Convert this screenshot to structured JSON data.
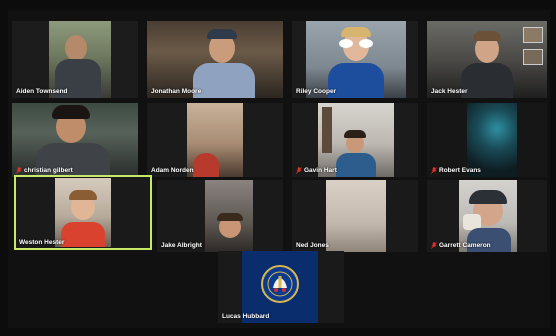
{
  "app": {
    "name": "Zoom gallery view"
  },
  "colors": {
    "active_speaker": "#c9e86a",
    "muted_icon": "#e0312b",
    "background": "#0b0b0b"
  },
  "participants": [
    {
      "name": "Aiden Townsend",
      "muted": false
    },
    {
      "name": "Jonathan Moore",
      "muted": false
    },
    {
      "name": "Riley Cooper",
      "muted": false
    },
    {
      "name": "Jack Hester",
      "muted": false
    },
    {
      "name": "christian gilbert",
      "muted": true
    },
    {
      "name": "Adam Norden",
      "muted": false
    },
    {
      "name": "Gavin Hart",
      "muted": true
    },
    {
      "name": "Robert Evans",
      "muted": true
    },
    {
      "name": "Weston Hester",
      "muted": false,
      "active_speaker": true
    },
    {
      "name": "Jake Albright",
      "muted": false
    },
    {
      "name": "Ned Jones",
      "muted": false
    },
    {
      "name": "Garrett Cameron",
      "muted": true
    },
    {
      "name": "Lucas Hubbard",
      "muted": false,
      "video_icon": "chelsea-fc-crest-icon"
    }
  ]
}
